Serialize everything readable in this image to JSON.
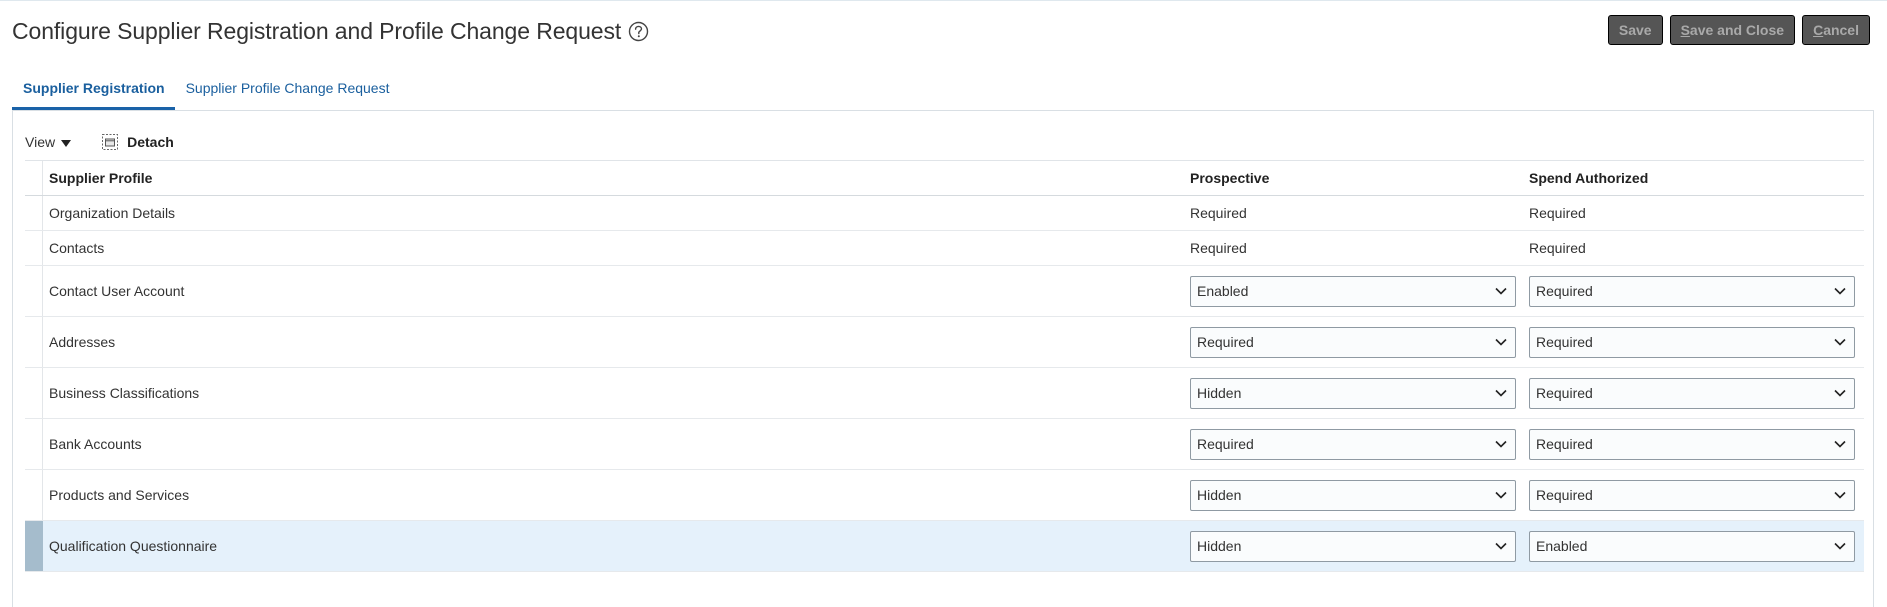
{
  "header": {
    "title": "Configure Supplier Registration and Profile Change Request"
  },
  "actions": {
    "save": "Save",
    "save_and_close_mnemonic": "S",
    "save_and_close_rest": "ave and Close",
    "cancel_mnemonic": "C",
    "cancel_rest": "ancel"
  },
  "tabs": [
    {
      "label": "Supplier Registration",
      "active": true
    },
    {
      "label": "Supplier Profile Change Request",
      "active": false
    }
  ],
  "toolbar": {
    "view_label": "View",
    "detach_label": "Detach"
  },
  "table": {
    "columns": [
      "Supplier Profile",
      "Prospective",
      "Spend Authorized"
    ],
    "rows": [
      {
        "profile": "Organization Details",
        "prospective": "Required",
        "spend_authorized": "Required"
      },
      {
        "profile": "Contacts",
        "prospective": "Required",
        "spend_authorized": "Required"
      },
      {
        "profile": "Contact User Account",
        "prospective": "Enabled",
        "spend_authorized": "Required"
      },
      {
        "profile": "Addresses",
        "prospective": "Required",
        "spend_authorized": "Required"
      },
      {
        "profile": "Business Classifications",
        "prospective": "Hidden",
        "spend_authorized": "Required"
      },
      {
        "profile": "Bank Accounts",
        "prospective": "Required",
        "spend_authorized": "Required"
      },
      {
        "profile": "Products and Services",
        "prospective": "Hidden",
        "spend_authorized": "Required"
      },
      {
        "profile": "Qualification Questionnaire",
        "prospective": "Hidden",
        "spend_authorized": "Enabled"
      }
    ]
  },
  "icons": {
    "help": "help-circle-icon",
    "view_caret": "caret-down-icon",
    "detach": "detach-icon",
    "dropdown": "chevron-down-icon"
  },
  "colors": {
    "link": "#1a5f9e",
    "button_bg": "#555555",
    "selected_row": "#e5f1fb"
  }
}
